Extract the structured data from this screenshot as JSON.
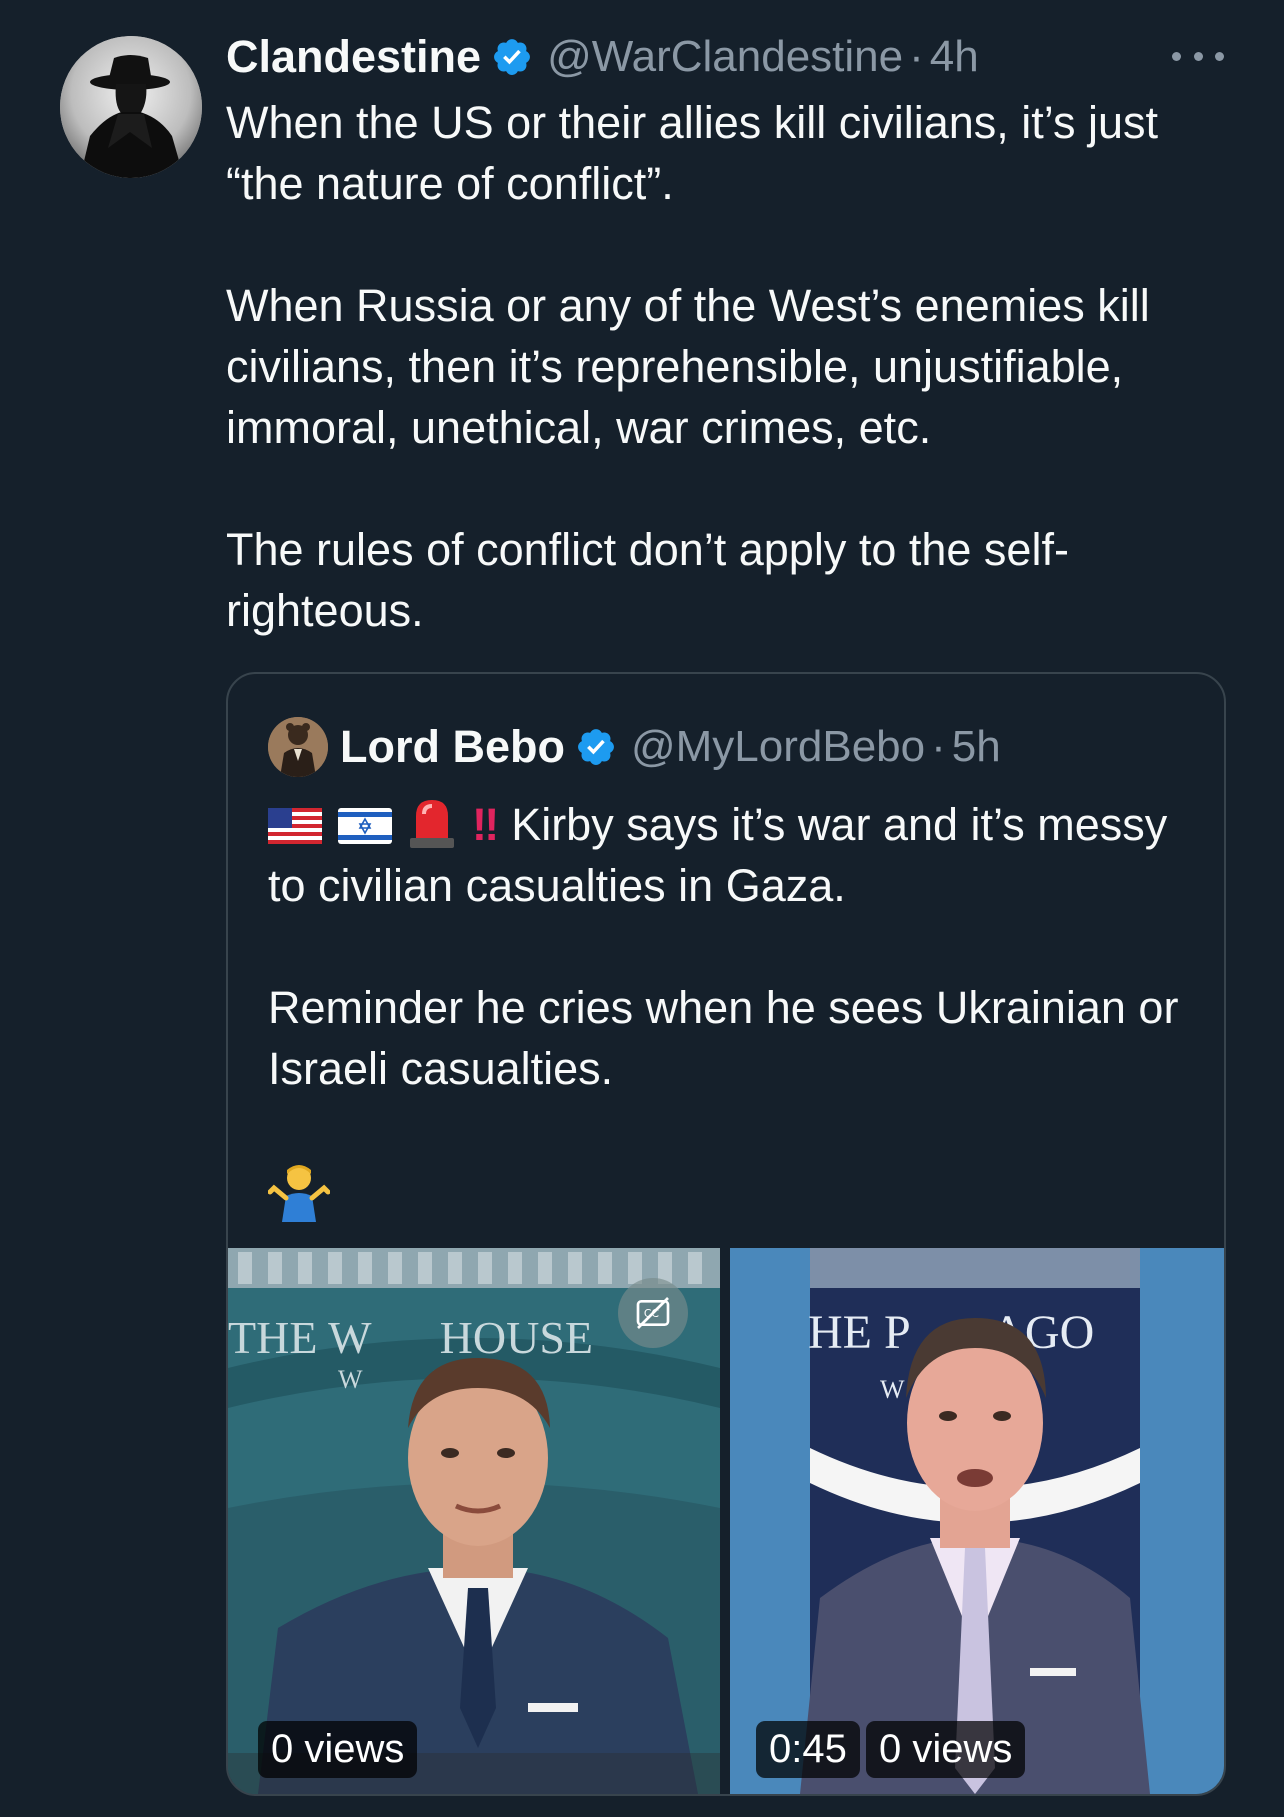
{
  "tweet": {
    "author": {
      "name": "Clandestine",
      "handle": "@WarClandestine",
      "separator": "·",
      "time": "4h",
      "avatar_icon": "spy-silhouette-avatar",
      "verified_icon": "verified-badge-icon"
    },
    "more_icon": "more-options-icon",
    "paragraphs": [
      "When the US or their allies kill civilians, it’s just “the nature of conflict”.",
      "When Russia or any of the West’s enemies kill civilians, then it’s reprehensible, unjustifiable, immoral, unethical, war crimes, etc.",
      "The rules of conflict don’t apply to the self-righteous."
    ]
  },
  "quote": {
    "author": {
      "name": "Lord Bebo",
      "handle": "@MyLordBebo",
      "separator": "·",
      "time": "5h",
      "avatar_icon": "bear-portrait-avatar",
      "verified_icon": "verified-badge-icon"
    },
    "emojis_line": [
      "us-flag-icon",
      "israel-flag-icon",
      "siren-icon"
    ],
    "exclamation": "‼",
    "paragraphs": [
      "Kirby says it’s war and it’s messy to civilian casualties in Gaza.",
      "Reminder he cries when he sees Ukrainian or Israeli casualties."
    ],
    "trailing_emoji": "person-shrugging-icon",
    "media": [
      {
        "backdrop_text_top": "THE W      HOUSE",
        "backdrop_text_sub": "W           TON",
        "views": "0 views",
        "cc_icon": "captions-off-icon"
      },
      {
        "backdrop_text_top": "HE P       AGO",
        "backdrop_text_sub": "W              N",
        "duration": "0:45",
        "views": "0 views"
      }
    ]
  },
  "colors": {
    "background": "#15202b",
    "text": "#f7f9f9",
    "muted": "#8b98a5",
    "verified": "#1d9bf0",
    "border": "#38444d"
  }
}
